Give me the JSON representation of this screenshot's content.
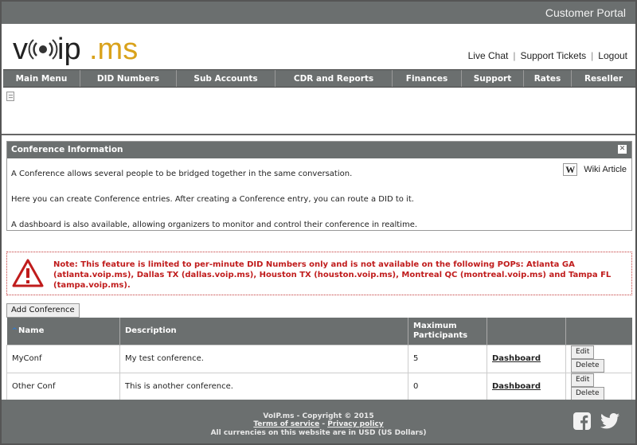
{
  "header": {
    "portal_title": "Customer Portal",
    "logo": "voip.ms",
    "links": [
      "Live Chat",
      "Support Tickets",
      "Logout"
    ]
  },
  "nav": {
    "items": [
      "Main Menu",
      "DID Numbers",
      "Sub Accounts",
      "CDR and Reports",
      "Finances",
      "Support",
      "Rates",
      "Reseller"
    ]
  },
  "info": {
    "title": "Conference Information",
    "close_label": "✕",
    "wiki_label": "Wiki Article",
    "wiki_icon_text": "W",
    "lines": [
      "A Conference allows several people to be bridged together in the same conversation.",
      "Here you can create Conference entries. After creating a Conference entry, you can route a DID to it.",
      "A dashboard is also available, allowing organizers to monitor and control their conference in realtime."
    ]
  },
  "warning": {
    "text": "Note: This feature is limited to per-minute DID Numbers only and is not available on the following POPs: Atlanta GA (atlanta.voip.ms), Dallas TX (dallas.voip.ms), Houston TX (houston.voip.ms), Montreal QC (montreal.voip.ms) and Tampa FL (tampa.voip.ms)."
  },
  "actions": {
    "add_conference": "Add Conference"
  },
  "table": {
    "headers": [
      "Name",
      "Description",
      "Maximum Participants",
      "",
      ""
    ],
    "rows": [
      {
        "name": "MyConf",
        "description": "My test conference.",
        "max": "5",
        "dashboard": "Dashboard",
        "edit": "Edit",
        "delete": "Delete"
      },
      {
        "name": "Other Conf",
        "description": "This is another conference.",
        "max": "0",
        "dashboard": "Dashboard",
        "edit": "Edit",
        "delete": "Delete"
      }
    ]
  },
  "footer": {
    "copyright": "VoIP.ms - Copyright © 2015",
    "terms": "Terms of service",
    "separator": " - ",
    "privacy": "Privacy policy",
    "currency_note": "All currencies on this website are in USD (US Dollars)"
  },
  "colors": {
    "bar": "#6b6f6f",
    "brand_accent": "#d9a21b",
    "warning": "#c01c1c"
  }
}
